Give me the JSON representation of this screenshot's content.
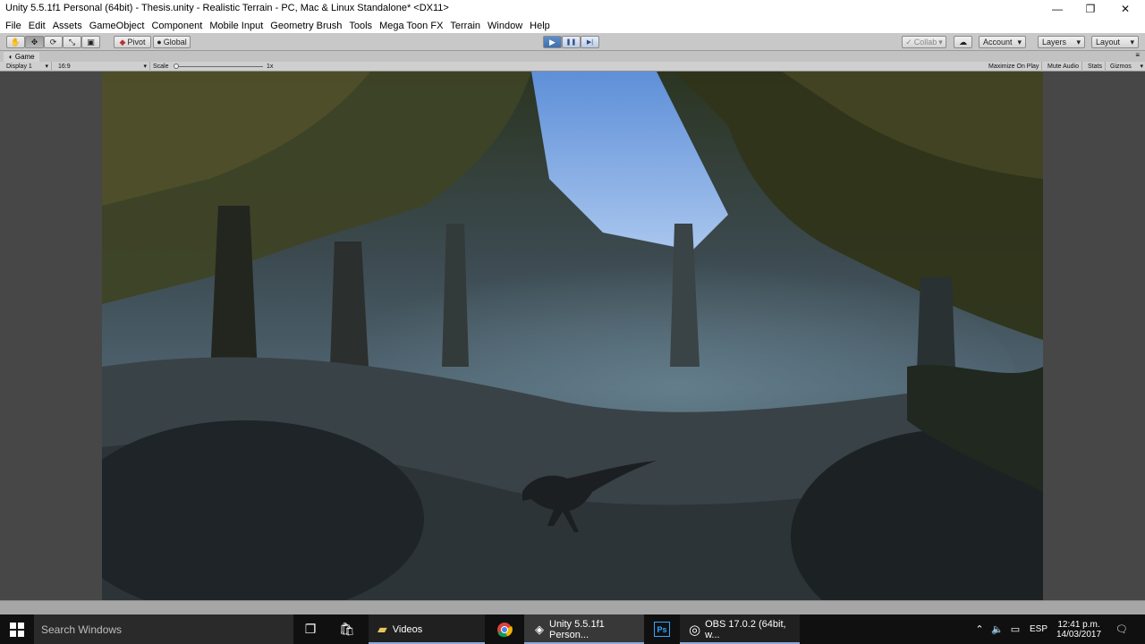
{
  "window": {
    "title": "Unity 5.5.1f1 Personal (64bit) - Thesis.unity - Realistic Terrain - PC, Mac & Linux Standalone* <DX11>",
    "minimize": "—",
    "maximize": "❐",
    "close": "✕"
  },
  "menu": [
    "File",
    "Edit",
    "Assets",
    "GameObject",
    "Component",
    "Mobile Input",
    "Geometry Brush",
    "Tools",
    "Mega Toon FX",
    "Terrain",
    "Window",
    "Help"
  ],
  "toolbar": {
    "tools": [
      "hand-icon",
      "move-icon",
      "rotate-icon",
      "scale-icon",
      "rect-icon"
    ],
    "pivot": "Pivot",
    "global": "Global",
    "play": "▶",
    "pause": "❚❚",
    "step": "▶|",
    "collab": "Collab",
    "account": "Account",
    "layers": "Layers",
    "layout": "Layout"
  },
  "game": {
    "tab_label": "Game",
    "display": "Display 1",
    "aspect": "16:9",
    "scale_label": "Scale",
    "scale_value": "1x",
    "maximize_on_play": "Maximize On Play",
    "mute_audio": "Mute Audio",
    "stats": "Stats",
    "gizmos": "Gizmos"
  },
  "taskbar": {
    "search_placeholder": "Search Windows",
    "apps": [
      {
        "label": "Videos",
        "icon": "folder-icon"
      },
      {
        "label": "",
        "icon": "chrome-icon"
      },
      {
        "label": "Unity 5.5.1f1 Person...",
        "icon": "unity-icon"
      },
      {
        "label": "",
        "icon": "photoshop-icon"
      },
      {
        "label": "OBS 17.0.2 (64bit, w...",
        "icon": "obs-icon"
      }
    ],
    "language": "ESP",
    "time": "12:41 p.m.",
    "date": "14/03/2017"
  },
  "colors": {
    "play_active": "#4a78b6",
    "taskbar": "#101010",
    "editor_gray": "#c2c2c2"
  }
}
